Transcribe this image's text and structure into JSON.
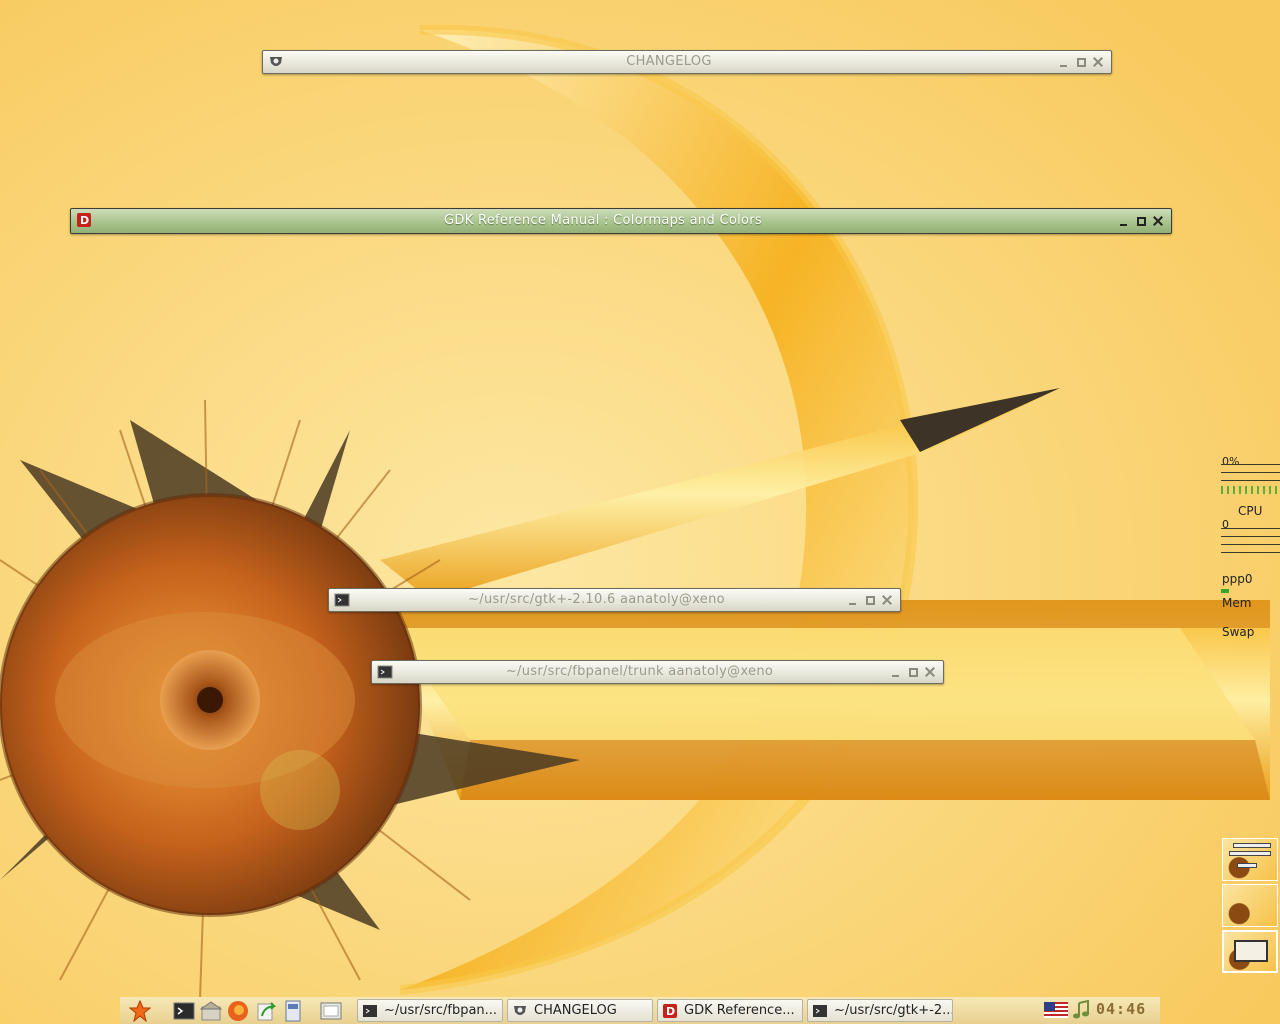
{
  "windows": [
    {
      "title": "CHANGELOG",
      "icon": "gnome-foot-icon",
      "state": "shaded"
    },
    {
      "title": "GDK Reference Manual : Colormaps and Colors",
      "icon": "devhelp-icon",
      "state": "shaded-active"
    },
    {
      "title": "~/usr/src/gtk+-2.10.6 aanatoly@xeno",
      "icon": "terminal-icon",
      "state": "shaded"
    },
    {
      "title": "~/usr/src/fbpanel/trunk aanatoly@xeno",
      "icon": "terminal-icon",
      "state": "shaded"
    }
  ],
  "monitors": {
    "cpu_percent": "0%",
    "cpu_label": "CPU",
    "net_value": "0",
    "net_label": "ppp0",
    "mem_label": "Mem",
    "swap_label": "Swap"
  },
  "pager": {
    "desktops": 3,
    "current": 3
  },
  "panel": {
    "launchers": [
      "menu-star-icon",
      "terminal-icon",
      "home-folder-icon",
      "firefox-icon",
      "arrow-launcher-icon",
      "file-manager-icon",
      "show-desktop-icon"
    ],
    "tasks": [
      {
        "label": "~/usr/src/fbpan...",
        "icon": "terminal-icon"
      },
      {
        "label": "CHANGELOG",
        "icon": "gnome-foot-icon"
      },
      {
        "label": "GDK Reference...",
        "icon": "devhelp-icon"
      },
      {
        "label": "~/usr/src/gtk+-2....",
        "icon": "terminal-icon"
      }
    ],
    "tray": [
      "us-flag-icon",
      "music-note-icon"
    ],
    "clock": "04:46"
  },
  "colors": {
    "background": "#fbd56e",
    "active_titlebar": "#a9c48e",
    "inactive_titlebar": "#e9e8dc",
    "clock": "#8c6c33"
  }
}
